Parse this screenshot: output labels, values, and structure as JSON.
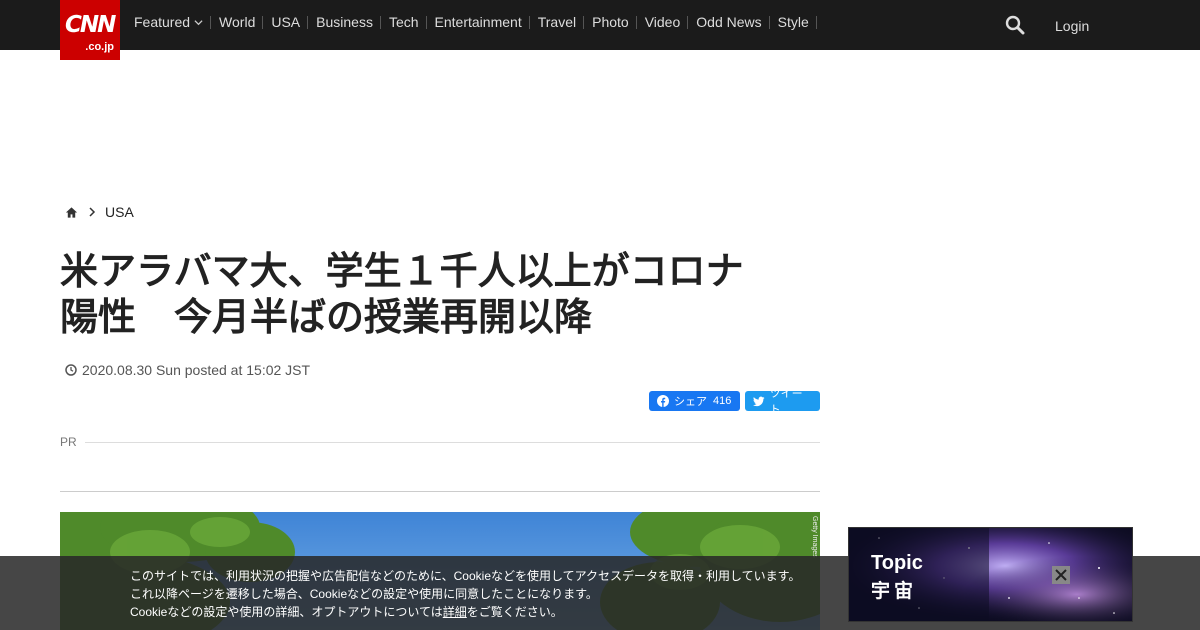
{
  "header": {
    "logo_main": "CNN",
    "logo_sub": ".co.jp",
    "nav": [
      "Featured",
      "World",
      "USA",
      "Business",
      "Tech",
      "Entertainment",
      "Travel",
      "Photo",
      "Video",
      "Odd News",
      "Style"
    ],
    "login": "Login",
    "colors": {
      "bar": "#1b1b1b",
      "logo": "#cc0000"
    }
  },
  "breadcrumb": {
    "home_icon": "home-icon",
    "section": "USA"
  },
  "article": {
    "title_line1": "米アラバマ大、学生１千人以上がコロナ",
    "title_line2": "陽性　今月半ばの授業再開以降",
    "date": "2020.08.30 Sun posted at 15:02 JST",
    "pr_label": "PR",
    "image_credit": "Getty Images"
  },
  "share": {
    "facebook_label": "シェア",
    "facebook_count": "416",
    "twitter_label": "ツイート"
  },
  "sidebar": {
    "topic_title": "Topic",
    "topic_subtitle": "宇宙"
  },
  "cookie": {
    "line1": "このサイトでは、利用状況の把握や広告配信などのために、Cookieなどを使用してアクセスデータを取得・利用しています。",
    "line2": "これ以降ページを遷移した場合、Cookieなどの設定や使用に同意したことになります。",
    "line3_before": "Cookieなどの設定や使用の詳細、オプトアウトについては",
    "line3_link": "詳細",
    "line3_after": "をご覧ください。"
  }
}
